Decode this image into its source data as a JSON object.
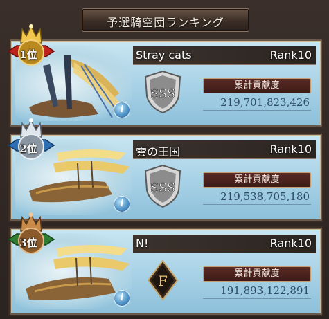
{
  "header": {
    "title": "予選騎空団ランキング"
  },
  "colors": {
    "rank1_ribbon": "#c0231e",
    "rank2_ribbon": "#2d6fb3",
    "rank3_ribbon": "#2e7d32",
    "contribution_bg": "#4a221d",
    "value_text": "#2d4a66"
  },
  "entries": [
    {
      "position_label": "1位",
      "team_name": "Stray cats",
      "rank": "Rank10",
      "grade": "SSS",
      "contribution_label": "累計貢献度",
      "contribution_value": "219,701,823,426",
      "badge_icon": "gold-crown-icon"
    },
    {
      "position_label": "2位",
      "team_name": "雲の王国",
      "rank": "Rank10",
      "grade": "SSS",
      "contribution_label": "累計貢献度",
      "contribution_value": "219,538,705,180",
      "badge_icon": "silver-crown-icon"
    },
    {
      "position_label": "3位",
      "team_name": "N!",
      "rank": "Rank10",
      "grade": "F",
      "contribution_label": "累計貢献度",
      "contribution_value": "191,893,122,891",
      "badge_icon": "bronze-crown-icon"
    }
  ]
}
